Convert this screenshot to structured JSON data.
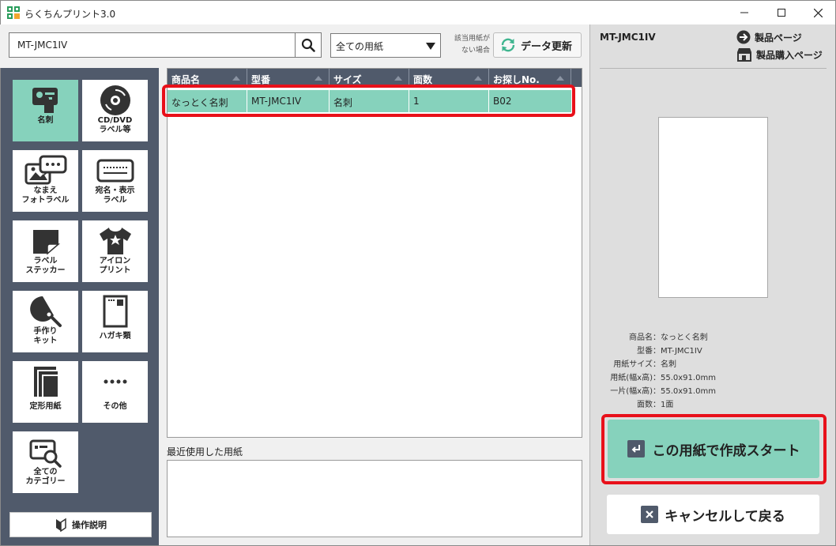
{
  "window": {
    "title": "らくちんプリント3.0"
  },
  "search": {
    "value": "MT-JMC1IV"
  },
  "paper_filter": {
    "selected": "全ての用紙"
  },
  "no_paper_note": {
    "line1": "該当用紙が",
    "line2": "ない場合"
  },
  "update_button": {
    "label": "データ更新"
  },
  "sidebar": {
    "categories": [
      {
        "label": "名刺",
        "active": true
      },
      {
        "label": "CD/DVD\nラベル等"
      },
      {
        "label": "なまえ\nフォトラベル"
      },
      {
        "label": "宛名・表示\nラベル"
      },
      {
        "label": "ラベル\nステッカー"
      },
      {
        "label": "アイロン\nプリント"
      },
      {
        "label": "手作り\nキット"
      },
      {
        "label": "ハガキ類"
      },
      {
        "label": "定形用紙"
      },
      {
        "label": "その他"
      },
      {
        "label": "全ての\nカテゴリー"
      }
    ],
    "manual_button": "操作説明"
  },
  "table": {
    "columns": [
      "商品名",
      "型番",
      "サイズ",
      "面数",
      "お探しNo."
    ],
    "rows": [
      [
        "なっとく名刺",
        "MT-JMC1IV",
        "名刺",
        "1",
        "B02"
      ]
    ]
  },
  "recent": {
    "label": "最近使用した用紙"
  },
  "detail": {
    "model": "MT-JMC1IV",
    "product_page_link": "製品ページ",
    "purchase_page_link": "製品購入ページ",
    "info": [
      {
        "key": "商品名：",
        "value": "なっとく名刺"
      },
      {
        "key": "型番：",
        "value": "MT-JMC1IV"
      },
      {
        "key": "用紙サイズ：",
        "value": "名刺"
      },
      {
        "key": "用紙(幅x高)：",
        "value": "55.0x91.0mm"
      },
      {
        "key": "一片(幅x高)：",
        "value": "55.0x91.0mm"
      },
      {
        "key": "面数：",
        "value": "1面"
      }
    ],
    "start_button": "この用紙で作成スタート",
    "cancel_button": "キャンセルして戻る"
  },
  "colors": {
    "accent": "#86d2bc",
    "sidebar": "#505a6b",
    "highlight": "#e8101a"
  }
}
